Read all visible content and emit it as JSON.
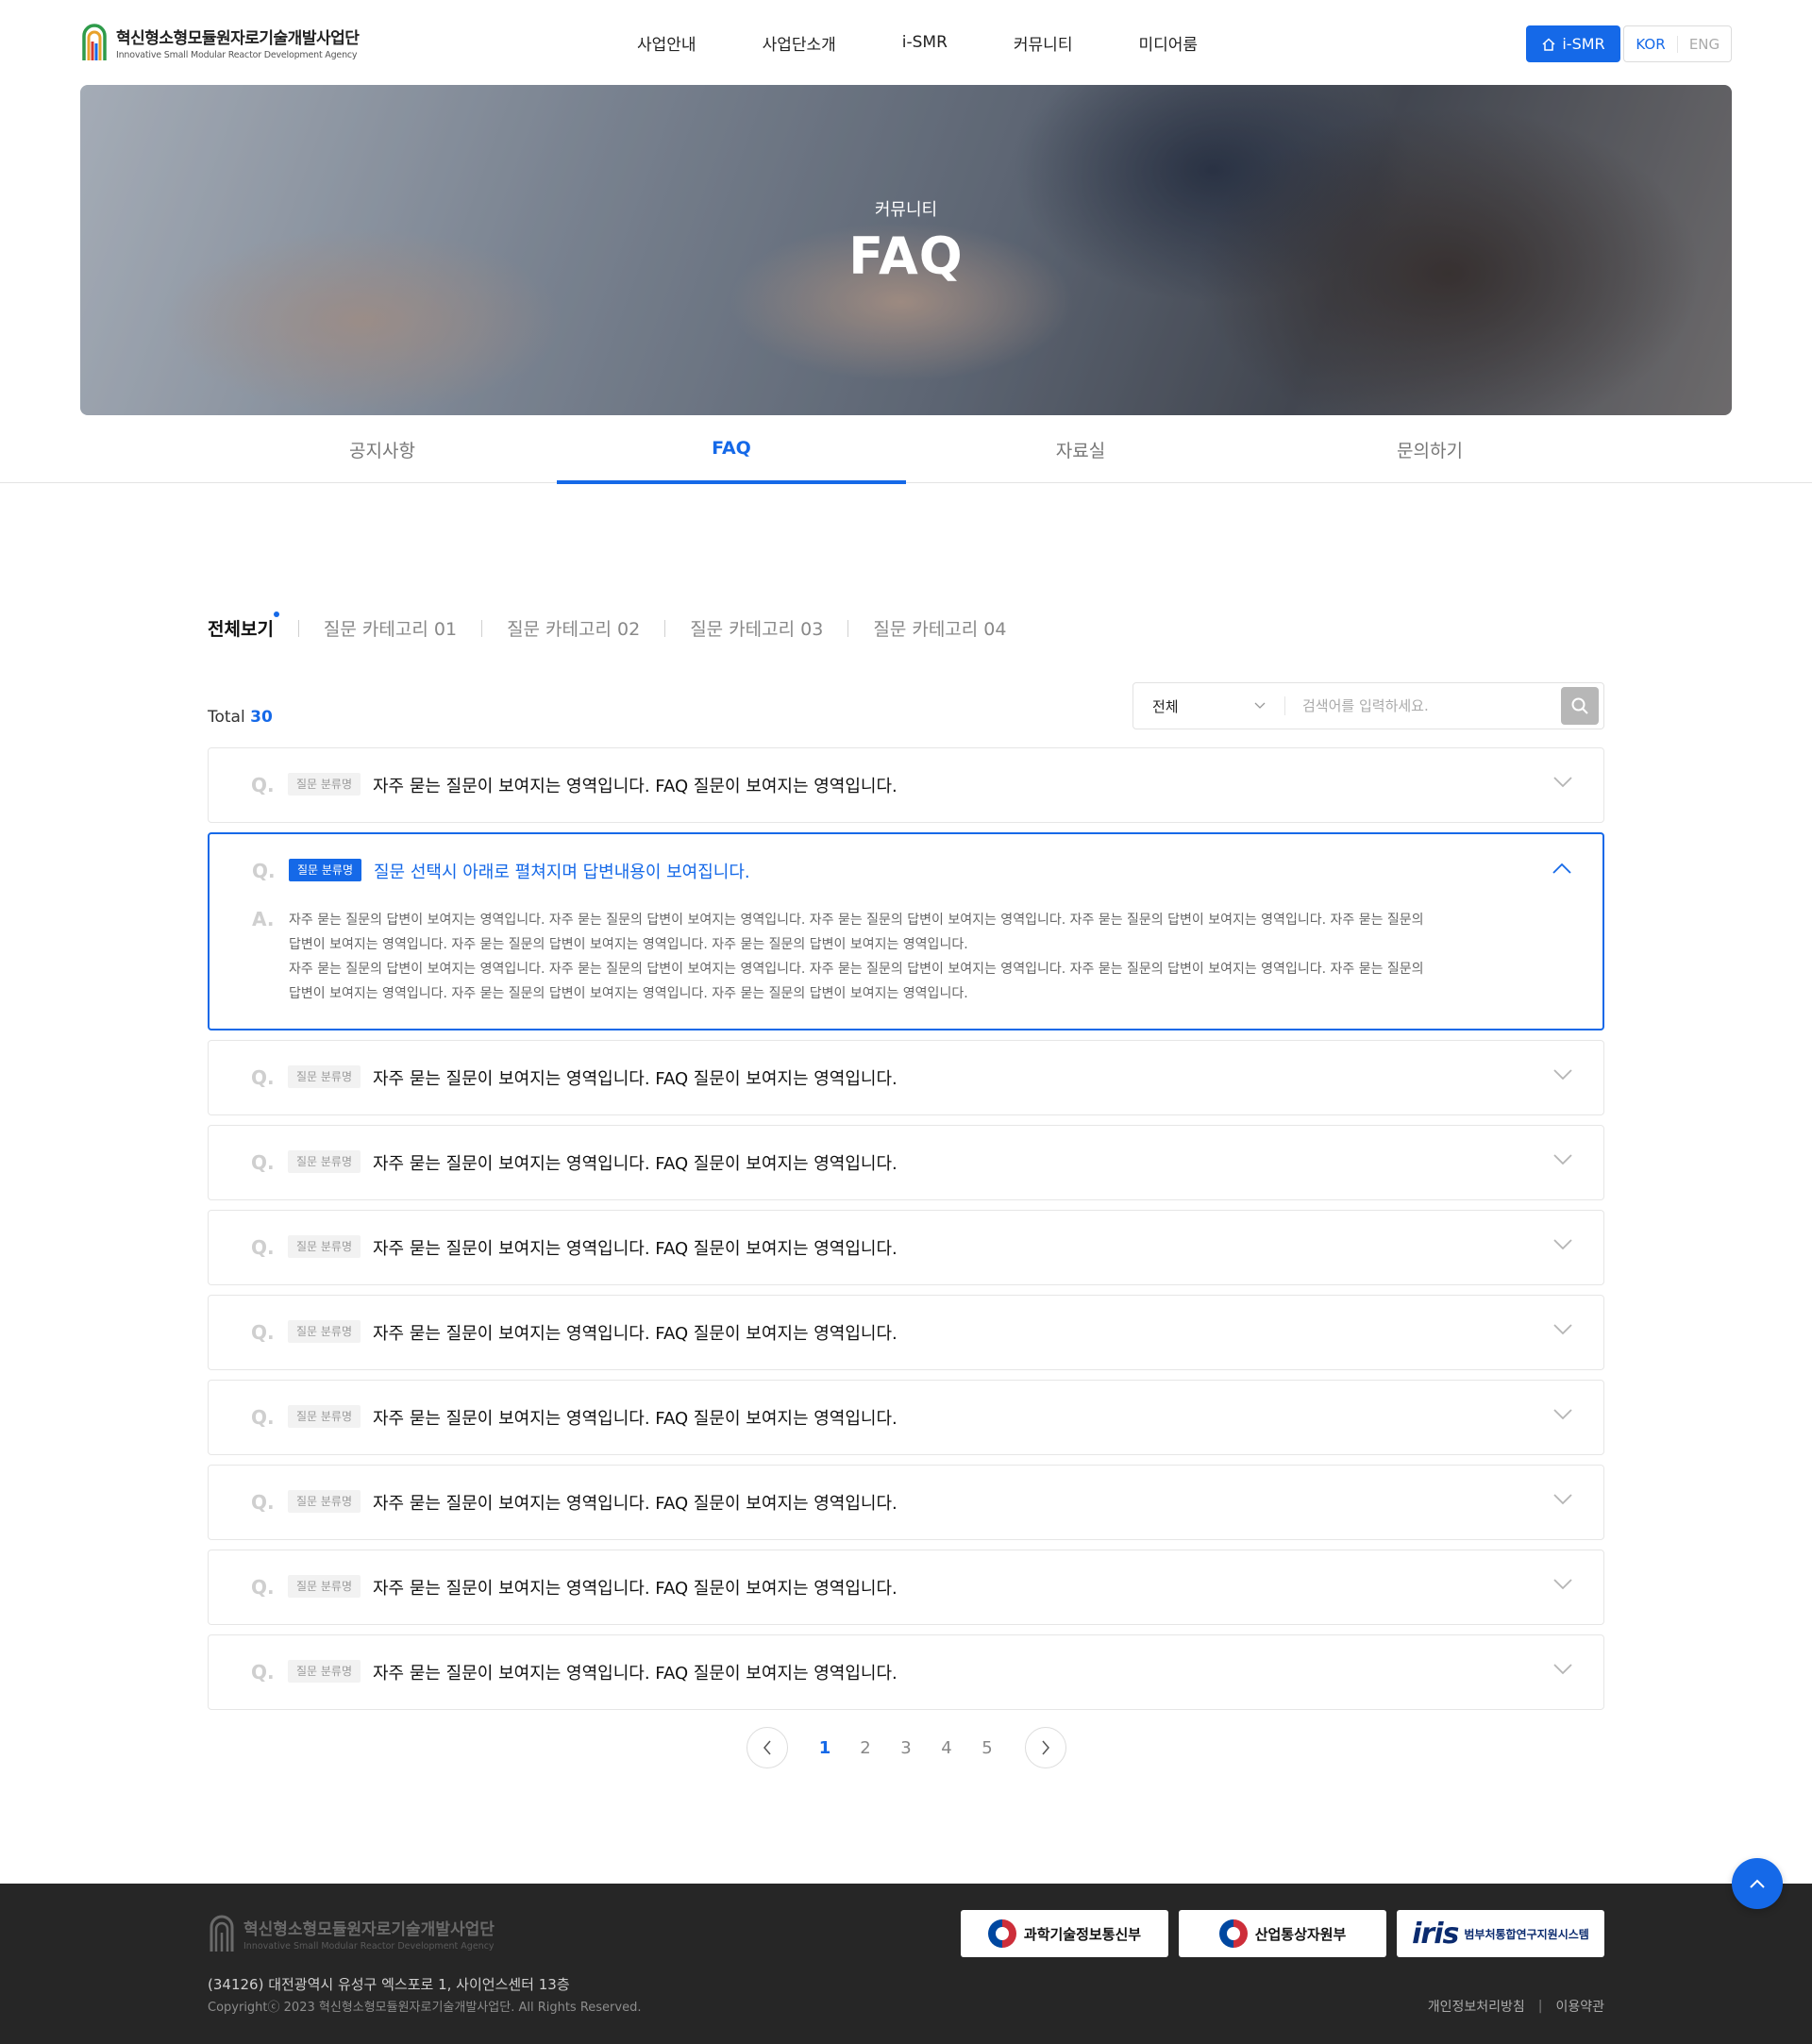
{
  "header": {
    "logo_ko": "혁신형소형모듈원자로기술개발사업단",
    "logo_en": "Innovative Small Modular Reactor Development Agency",
    "nav": [
      "사업안내",
      "사업단소개",
      "i-SMR",
      "커뮤니티",
      "미디어룸"
    ],
    "home_label": "i-SMR",
    "lang_kor": "KOR",
    "lang_eng": "ENG"
  },
  "hero": {
    "subtitle": "커뮤니티",
    "title": "FAQ"
  },
  "subtabs": [
    "공지사항",
    "FAQ",
    "자료실",
    "문의하기"
  ],
  "subtab_active": "FAQ",
  "categories": [
    "전체보기",
    "질문 카테고리 01",
    "질문 카테고리 02",
    "질문 카테고리 03",
    "질문 카테고리 04"
  ],
  "total": {
    "label": "Total",
    "count": "30"
  },
  "search": {
    "select_value": "전체",
    "placeholder": "검색어를 입력하세요."
  },
  "faq": {
    "q_mark": "Q.",
    "a_mark": "A.",
    "badge": "질문 분류명",
    "items": [
      {
        "question": "자주 묻는 질문이 보여지는 영역입니다. FAQ 질문이 보여지는 영역입니다.",
        "open": false
      },
      {
        "question": "질문 선택시 아래로 펼쳐지며 답변내용이 보여집니다.",
        "open": true,
        "answer_lines": [
          "자주 묻는 질문의 답변이 보여지는 영역입니다. 자주 묻는 질문의 답변이 보여지는 영역입니다. 자주 묻는 질문의 답변이 보여지는 영역입니다. 자주 묻는 질문의 답변이 보여지는 영역입니다. 자주 묻는 질문의",
          "답변이 보여지는 영역입니다. 자주 묻는 질문의 답변이 보여지는 영역입니다. 자주 묻는 질문의 답변이 보여지는 영역입니다.",
          "자주 묻는 질문의 답변이 보여지는 영역입니다. 자주 묻는 질문의 답변이 보여지는 영역입니다. 자주 묻는 질문의 답변이 보여지는 영역입니다. 자주 묻는 질문의 답변이 보여지는 영역입니다. 자주 묻는 질문의",
          "답변이 보여지는 영역입니다. 자주 묻는 질문의 답변이 보여지는 영역입니다. 자주 묻는 질문의 답변이 보여지는 영역입니다."
        ]
      },
      {
        "question": "자주 묻는 질문이 보여지는 영역입니다. FAQ 질문이 보여지는 영역입니다.",
        "open": false
      },
      {
        "question": "자주 묻는 질문이 보여지는 영역입니다. FAQ 질문이 보여지는 영역입니다.",
        "open": false
      },
      {
        "question": "자주 묻는 질문이 보여지는 영역입니다. FAQ 질문이 보여지는 영역입니다.",
        "open": false
      },
      {
        "question": "자주 묻는 질문이 보여지는 영역입니다. FAQ 질문이 보여지는 영역입니다.",
        "open": false
      },
      {
        "question": "자주 묻는 질문이 보여지는 영역입니다. FAQ 질문이 보여지는 영역입니다.",
        "open": false
      },
      {
        "question": "자주 묻는 질문이 보여지는 영역입니다. FAQ 질문이 보여지는 영역입니다.",
        "open": false
      },
      {
        "question": "자주 묻는 질문이 보여지는 영역입니다. FAQ 질문이 보여지는 영역입니다.",
        "open": false
      },
      {
        "question": "자주 묻는 질문이 보여지는 영역입니다. FAQ 질문이 보여지는 영역입니다.",
        "open": false
      }
    ]
  },
  "pagination": {
    "pages": [
      "1",
      "2",
      "3",
      "4",
      "5"
    ],
    "current": "1"
  },
  "footer": {
    "logo_ko": "혁신형소형모듈원자로기술개발사업단",
    "logo_en": "Innovative Small Modular Reactor Development Agency",
    "address": "(34126) 대전광역시 유성구 엑스포로 1, 사이언스센터 13층",
    "copyright": "Copyrightⓒ 2023 혁신형소형모듈원자로기술개발사업단. All Rights Reserved.",
    "banners": [
      {
        "label": "과학기술정보통신부"
      },
      {
        "label": "산업통상자원부"
      },
      {
        "logo_text": "iris",
        "label": "범부처통합연구지원시스템"
      }
    ],
    "links": [
      "개인정보처리방침",
      "이용약관"
    ]
  },
  "colors": {
    "accent": "#1569e8",
    "footer_bg": "#262626"
  }
}
